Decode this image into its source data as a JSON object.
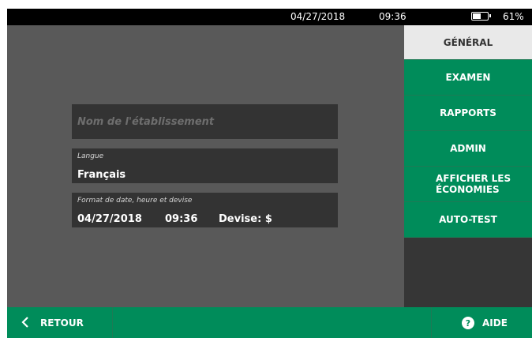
{
  "status_bar": {
    "date": "04/27/2018",
    "time": "09:36",
    "battery_percent": "61%",
    "battery_level": 0.61
  },
  "fields": {
    "facility_name": {
      "placeholder": "Nom de l'établissement",
      "value": ""
    },
    "language": {
      "label": "Langue",
      "value": "Français"
    },
    "date_format": {
      "label": "Format de date, heure et devise",
      "date": "04/27/2018",
      "time": "09:36",
      "currency": "Devise: $"
    }
  },
  "nav": {
    "tabs": [
      {
        "label": "GÉNÉRAL",
        "active": true
      },
      {
        "label": "EXAMEN",
        "active": false
      },
      {
        "label": "RAPPORTS",
        "active": false
      },
      {
        "label": "ADMIN",
        "active": false
      },
      {
        "label": "AFFICHER LES ÉCONOMIES",
        "active": false
      },
      {
        "label": "AUTO-TEST",
        "active": false
      }
    ]
  },
  "bottom_bar": {
    "back_label": "RETOUR",
    "help_label": "AIDE",
    "help_icon": "question-circle-icon",
    "back_icon": "chevron-left-icon"
  },
  "colors": {
    "accent": "#008c5a",
    "background": "#595959",
    "field_bg": "#333333",
    "active_tab": "#e9e9e9"
  }
}
